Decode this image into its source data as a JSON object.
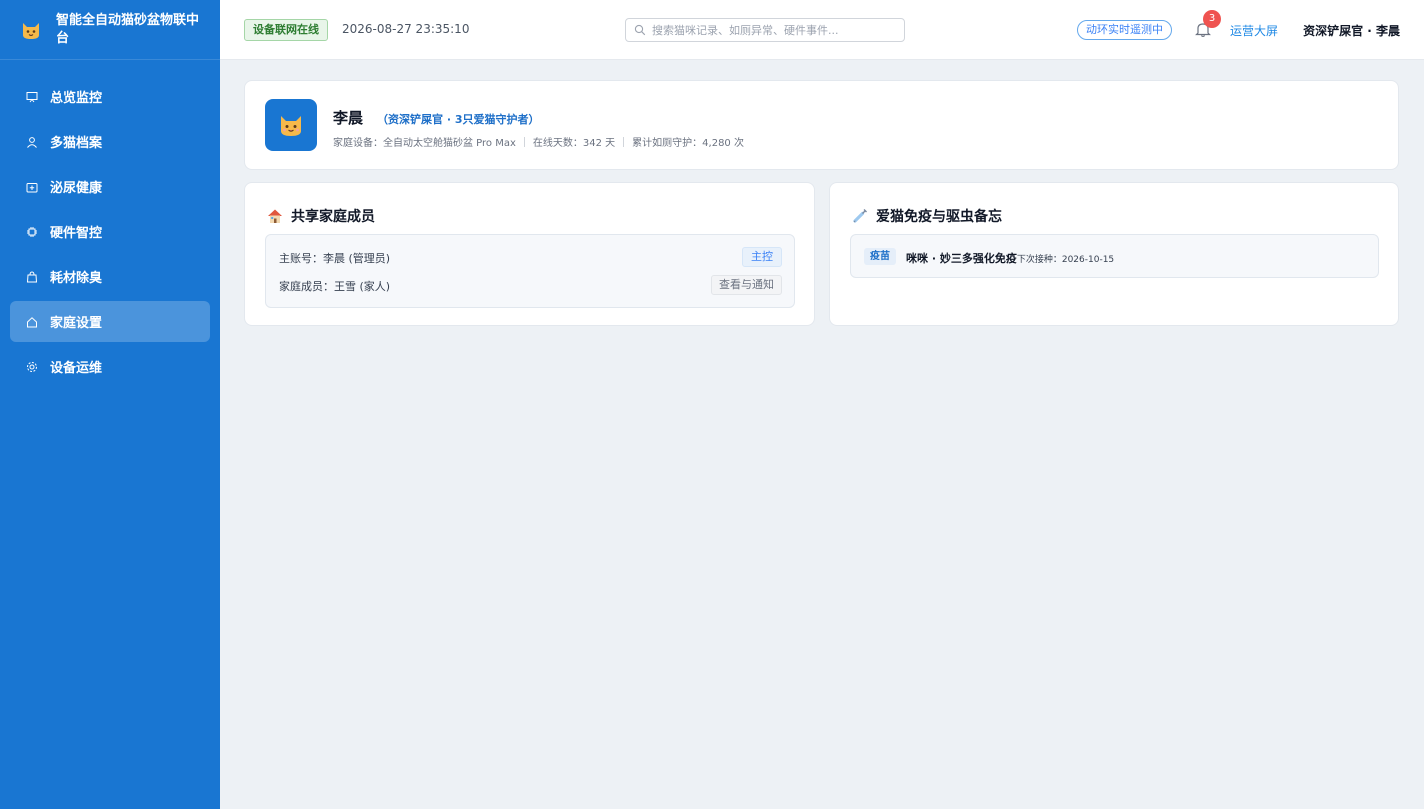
{
  "brand": {
    "title": "智能全自动猫砂盆物联中台",
    "logo_icon": "cat-face-icon"
  },
  "sidebar": {
    "items": [
      {
        "label": "总览监控",
        "icon": "monitor-icon",
        "active": false
      },
      {
        "label": "多猫档案",
        "icon": "user-icon",
        "active": false
      },
      {
        "label": "泌尿健康",
        "icon": "medical-box-icon",
        "active": false
      },
      {
        "label": "硬件智控",
        "icon": "chip-icon",
        "active": false
      },
      {
        "label": "耗材除臭",
        "icon": "bag-icon",
        "active": false
      },
      {
        "label": "家庭设置",
        "icon": "home-icon",
        "active": true
      },
      {
        "label": "设备运维",
        "icon": "gear-icon",
        "active": false
      }
    ]
  },
  "header": {
    "status": "设备联网在线",
    "datetime": "2026-08-27 23:35:10",
    "search_placeholder": "搜索猫咪记录、如厕异常、硬件事件...",
    "realtime": "动环实时遥测中",
    "notification_count": "3",
    "ops_link": "运营大屏",
    "user": "资深铲屎官 · 李晨"
  },
  "profile": {
    "name": "李晨",
    "role": "（资深铲屎官 · 3只爱猫守护者）",
    "device": "家庭设备：全自动太空舱猫砂盆 Pro Max",
    "online_days": "在线天数：342 天",
    "guard_count": "累计如厕守护：4,280 次"
  },
  "family": {
    "title": "共享家庭成员",
    "title_icon": "house-icon",
    "rows": [
      {
        "text": "主账号：李晨 (管理员)",
        "tag": "主控"
      },
      {
        "text": "家庭成员：王雪 (家人)",
        "action": "查看与通知"
      }
    ]
  },
  "vaccine": {
    "title": "爱猫免疫与驱虫备忘",
    "title_icon": "syringe-icon",
    "item": {
      "tag": "疫苗",
      "name": "咪咪 · 妙三多强化免疫",
      "next_label": "下次接种：2026-10-15"
    }
  },
  "colors": {
    "sidebar_bg": "#1976d2",
    "page_bg": "#edf1f5",
    "accent": "#1e88e5",
    "online_green": "#2e7d32",
    "badge_red": "#ef5350"
  }
}
